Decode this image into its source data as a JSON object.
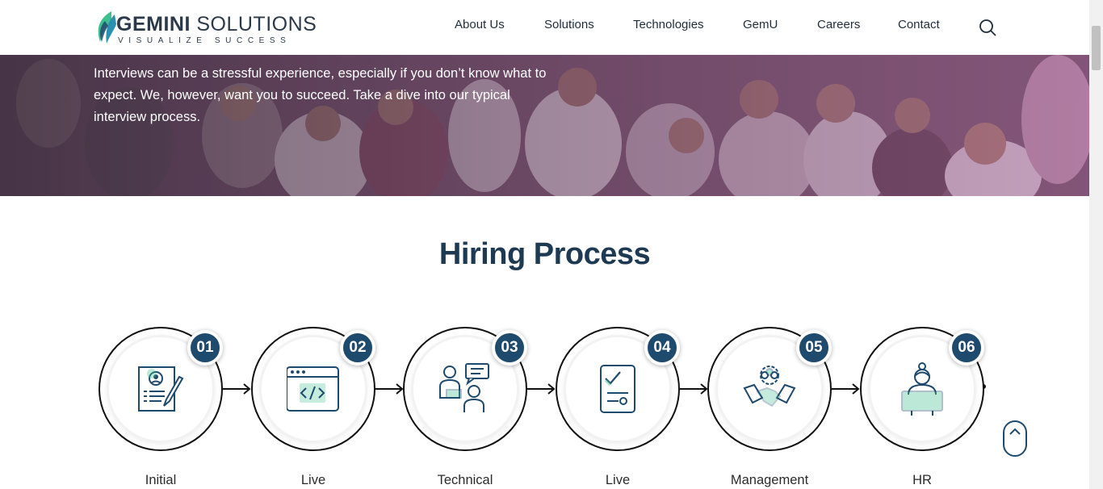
{
  "brand": {
    "name_bold": "GEMINI",
    "name_rest": " SOLUTIONS",
    "tagline": "VISUALIZE SUCCESS"
  },
  "nav": {
    "items": [
      {
        "label": "About Us"
      },
      {
        "label": "Solutions"
      },
      {
        "label": "Technologies"
      },
      {
        "label": "GemU"
      },
      {
        "label": "Careers"
      },
      {
        "label": "Contact"
      }
    ]
  },
  "hero": {
    "text": "Interviews can be a stressful experience, especially if you don’t know what to expect. We, however, want you to succeed. Take a dive into our typical interview process."
  },
  "section": {
    "title": "Hiring Process"
  },
  "steps": [
    {
      "number": "01",
      "label": "Initial",
      "icon": "resume-icon"
    },
    {
      "number": "02",
      "label": "Live",
      "icon": "code-window-icon"
    },
    {
      "number": "03",
      "label": "Technical",
      "icon": "interview-icon"
    },
    {
      "number": "04",
      "label": "Live",
      "icon": "checklist-icon"
    },
    {
      "number": "05",
      "label": "Management",
      "icon": "handshake-icon"
    },
    {
      "number": "06",
      "label": "HR",
      "icon": "hr-icon"
    }
  ],
  "colors": {
    "primary": "#1e4a6e",
    "accent_green": "#3fbf8f",
    "title": "#1e3a53"
  }
}
